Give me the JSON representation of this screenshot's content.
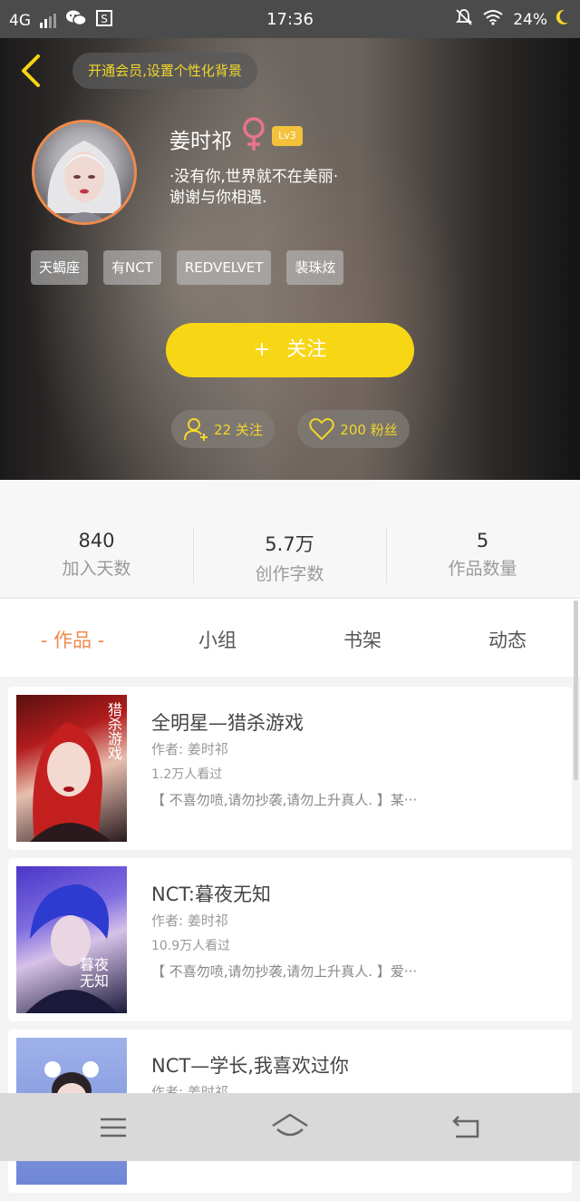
{
  "status_bar": {
    "network": "4G",
    "time": "17:36",
    "battery": "24%",
    "icons": [
      "signal-icon",
      "wechat-icon",
      "s-app-icon",
      "mute-icon",
      "wifi-icon",
      "night-icon"
    ]
  },
  "header": {
    "vip_prompt": "开通会员,设置个性化背景",
    "username": "姜时祁",
    "gender_icon": "female-icon",
    "level": "Lv3",
    "bio_lines": [
      "·没有你,世界就不在美丽·",
      "谢谢与你相遇."
    ],
    "tags": [
      "天蝎座",
      "有NCT",
      "REDVELVET",
      "裴珠炫"
    ],
    "follow_button": {
      "icon": "plus",
      "label": "关注"
    },
    "following_label": "22 关注",
    "fans_label": "200 粉丝",
    "colors": {
      "accent_yellow": "#f7d615",
      "avatar_ring": "#f08a4b",
      "level_badge": "#f3c23a"
    }
  },
  "stats": [
    {
      "value": "840",
      "label": "加入天数"
    },
    {
      "value": "5.7万",
      "label": "创作字数"
    },
    {
      "value": "5",
      "label": "作品数量"
    }
  ],
  "tabs": [
    {
      "label": "- 作品 -",
      "active": true
    },
    {
      "label": "小组",
      "active": false
    },
    {
      "label": "书架",
      "active": false
    },
    {
      "label": "动态",
      "active": false
    }
  ],
  "works": [
    {
      "title": "全明星—猎杀游戏",
      "author": "作者: 姜时祁",
      "views": "1.2万人看过",
      "desc": "【 不喜勿喷,请勿抄袭,请勿上升真人. 】某···",
      "cover_text": "猎杀游戏"
    },
    {
      "title": "NCT:暮夜无知",
      "author": "作者: 姜时祁",
      "views": "10.9万人看过",
      "desc": "【 不喜勿喷,请勿抄袭,请勿上升真人. 】爱···",
      "cover_text": "暮夜无知"
    },
    {
      "title": "NCT—学长,我喜欢过你",
      "author": "作者: 姜时祁",
      "views": "",
      "desc": "",
      "cover_text": ""
    }
  ],
  "nav_bar": {
    "icons": [
      "menu-icon",
      "home-icon",
      "back-icon"
    ]
  }
}
